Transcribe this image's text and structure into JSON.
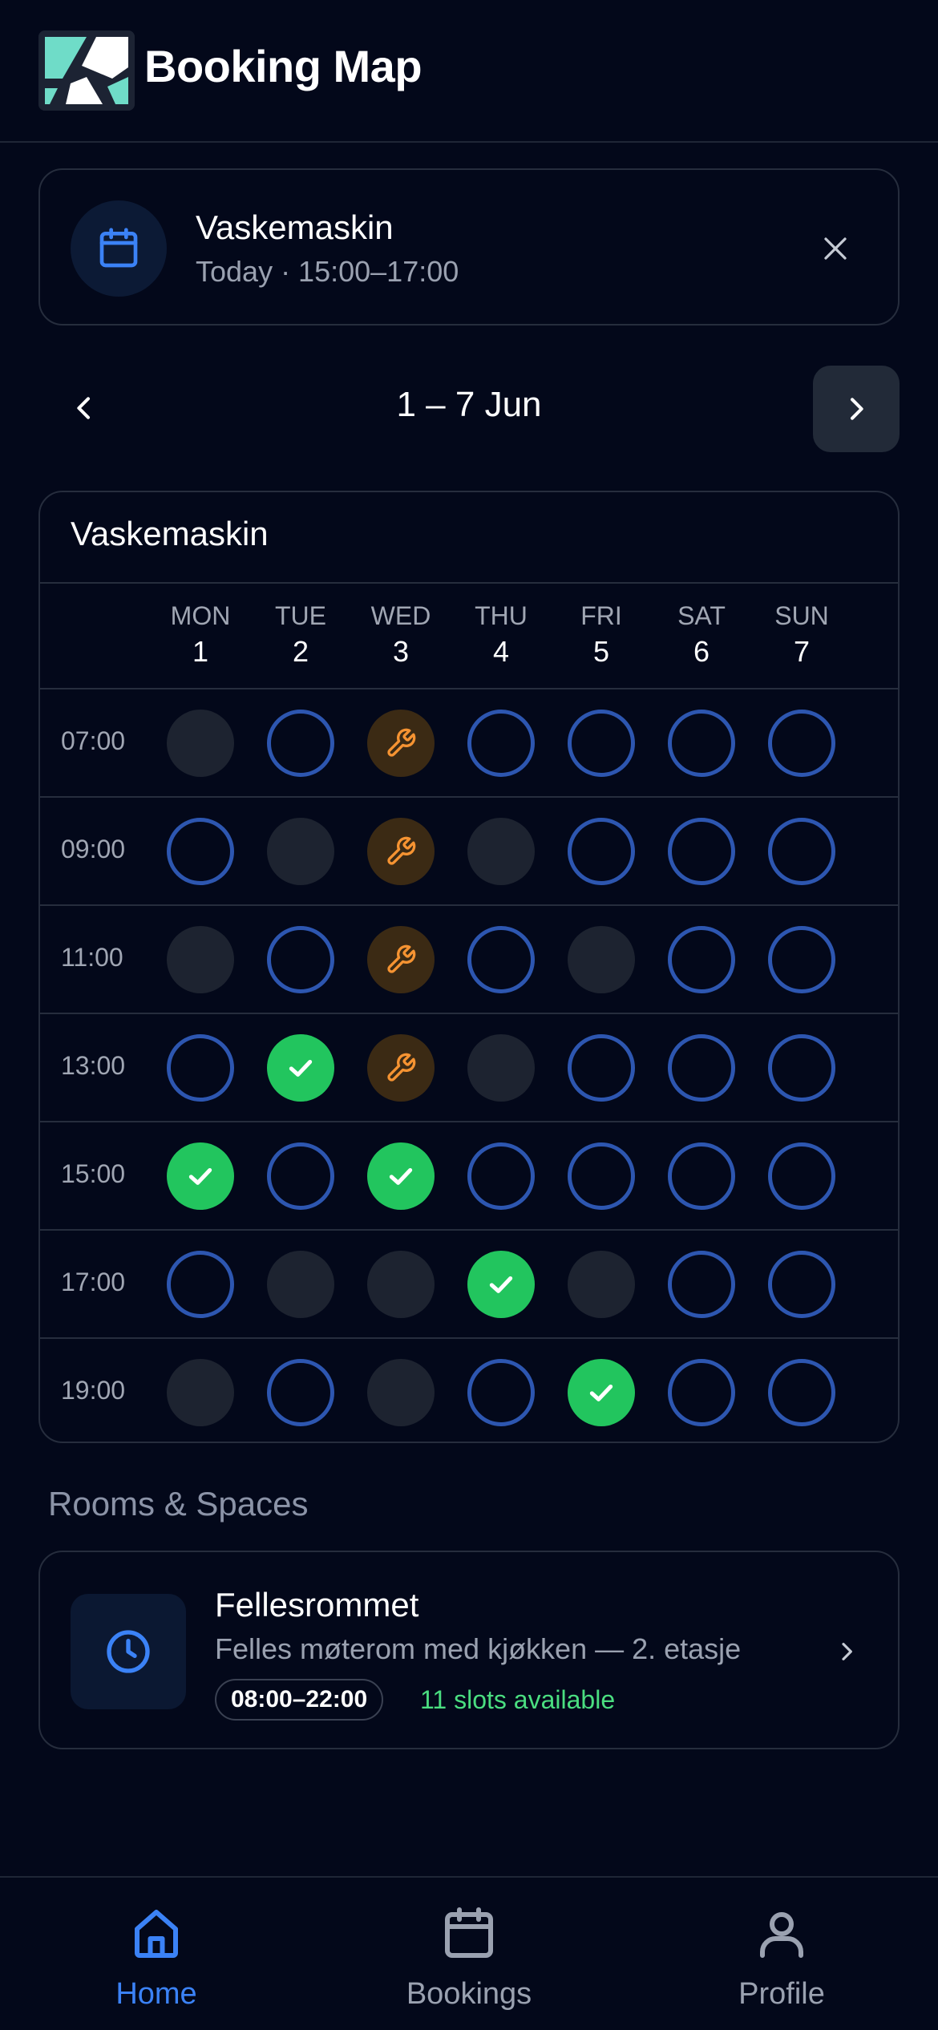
{
  "app": {
    "title": "Booking Map"
  },
  "selected_booking": {
    "name": "Vaskemaskin",
    "time": "Today · 15:00–17:00"
  },
  "week": {
    "label": "1 – 7 Jun"
  },
  "calendar": {
    "title": "Vaskemaskin",
    "days": [
      {
        "name": "MON",
        "num": "1"
      },
      {
        "name": "TUE",
        "num": "2"
      },
      {
        "name": "WED",
        "num": "3"
      },
      {
        "name": "THU",
        "num": "4"
      },
      {
        "name": "FRI",
        "num": "5"
      },
      {
        "name": "SAT",
        "num": "6"
      },
      {
        "name": "SUN",
        "num": "7"
      }
    ],
    "rows": [
      {
        "time": "07:00",
        "slots": [
          "taken",
          "free",
          "maint",
          "free",
          "free",
          "free",
          "free"
        ]
      },
      {
        "time": "09:00",
        "slots": [
          "free",
          "taken",
          "maint",
          "taken",
          "free",
          "free",
          "free"
        ]
      },
      {
        "time": "11:00",
        "slots": [
          "taken",
          "free",
          "maint",
          "free",
          "taken",
          "free",
          "free"
        ]
      },
      {
        "time": "13:00",
        "slots": [
          "free",
          "mine",
          "maint",
          "taken",
          "free",
          "free",
          "free"
        ]
      },
      {
        "time": "15:00",
        "slots": [
          "mine",
          "free",
          "mine",
          "free",
          "free",
          "free",
          "free"
        ]
      },
      {
        "time": "17:00",
        "slots": [
          "free",
          "taken",
          "taken",
          "mine",
          "taken",
          "free",
          "free"
        ]
      },
      {
        "time": "19:00",
        "slots": [
          "taken",
          "free",
          "taken",
          "free",
          "mine",
          "free",
          "free"
        ]
      }
    ]
  },
  "rooms": {
    "section_title": "Rooms & Spaces",
    "items": [
      {
        "name": "Fellesrommet",
        "description": "Felles møterom med kjøkken — 2. etasje",
        "hours": "08:00–22:00",
        "availability": "11 slots available"
      }
    ]
  },
  "bottom_nav": [
    {
      "label": "Home",
      "icon": "home-icon",
      "active": true
    },
    {
      "label": "Bookings",
      "icon": "calendar-icon",
      "active": false
    },
    {
      "label": "Profile",
      "icon": "user-icon",
      "active": false
    }
  ],
  "colors": {
    "background": "#03081a",
    "free_ring": "#2d56b0",
    "taken": "#1d2330",
    "mine": "#22c55e",
    "maintenance_bg": "#3b2a14",
    "maintenance_icon": "#f59332",
    "accent_blue": "#3b82f6",
    "available_green": "#4ade80"
  }
}
